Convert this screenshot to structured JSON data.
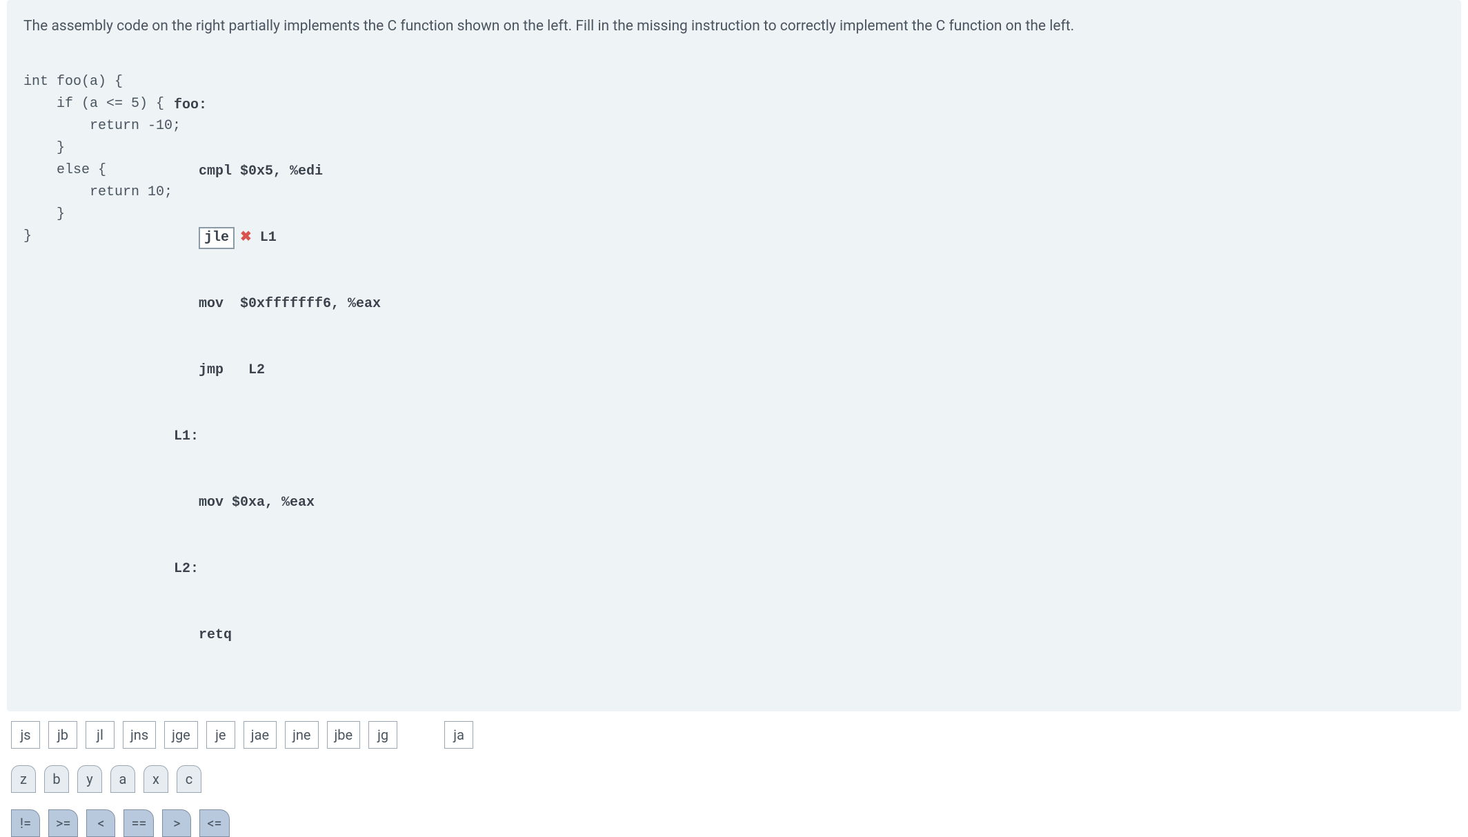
{
  "prompt": "The assembly code on the right partially implements the C function shown on the left. Fill in the missing instruction to correctly implement the C function on the left.",
  "c_code": "int foo(a) {\n    if (a <= 5) {\n        return -10;\n    }\n    else {\n        return 10;\n    }\n}",
  "asm": {
    "label0": "foo:",
    "line1": "cmpl $0x5, %edi",
    "blank_value": "jle",
    "blank_suffix": "L1",
    "line3": "mov  $0xfffffff6, %eax",
    "line4": "jmp   L2",
    "label1": "L1:",
    "line5": "mov $0xa, %eax",
    "label2": "L2:",
    "line6": "retq"
  },
  "status": {
    "wrong_glyph": "✖"
  },
  "tokens_row1": [
    "js",
    "jb",
    "jl",
    "jns",
    "jge",
    "je",
    "jae",
    "jne",
    "jbe",
    "jg",
    "ja"
  ],
  "tokens_row2": [
    "z",
    "b",
    "y",
    "a",
    "x",
    "c"
  ],
  "tokens_row3": [
    "!=",
    ">=",
    "<",
    "==",
    ">",
    "<="
  ]
}
